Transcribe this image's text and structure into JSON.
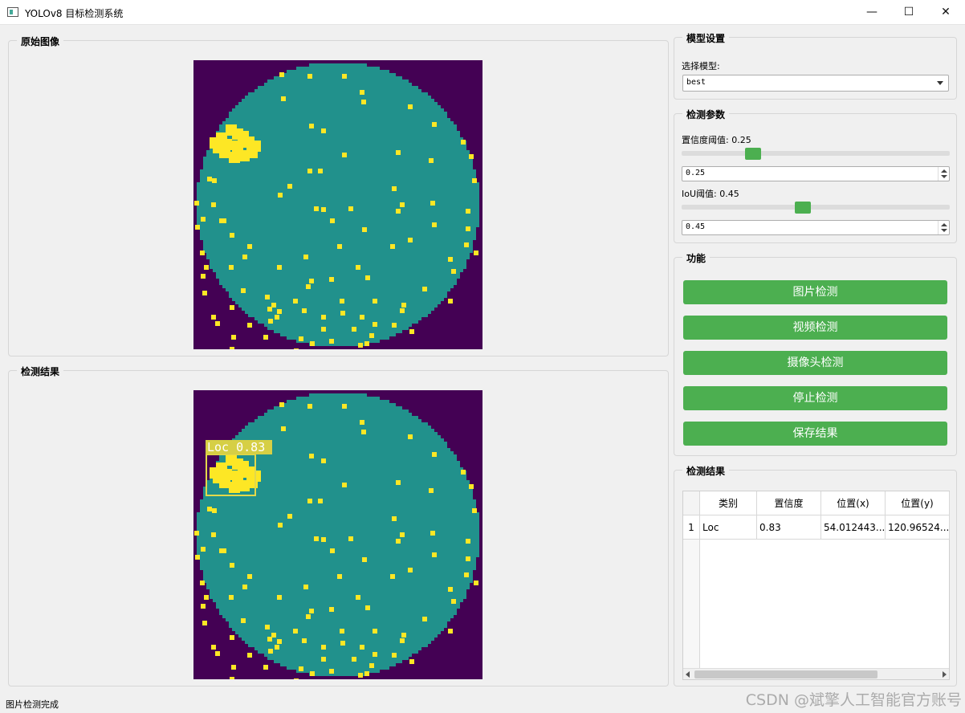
{
  "window": {
    "title": "YOLOv8 目标检测系统",
    "controls": {
      "minimize": "—",
      "maximize": "☐",
      "close": "✕"
    }
  },
  "left": {
    "original_title": "原始图像",
    "result_title": "检测结果",
    "detection_label": "Loc 0.83"
  },
  "model": {
    "group_title": "模型设置",
    "select_label": "选择模型:",
    "selected_model": "best"
  },
  "params": {
    "group_title": "检测参数",
    "conf_label": "置信度阈值: 0.25",
    "conf_value": "0.25",
    "conf_fraction": 0.25,
    "iou_label": "IoU阈值: 0.45",
    "iou_value": "0.45",
    "iou_fraction": 0.45
  },
  "functions": {
    "group_title": "功能",
    "buttons": [
      "图片检测",
      "视频检测",
      "摄像头检测",
      "停止检测",
      "保存结果"
    ]
  },
  "results": {
    "group_title": "检测结果",
    "headers": [
      "类别",
      "置信度",
      "位置(x)",
      "位置(y)"
    ],
    "rows": [
      {
        "index": "1",
        "cells": [
          "Loc",
          "0.83",
          "54.012443...",
          "120.96524..."
        ]
      }
    ]
  },
  "status": "图片检测完成",
  "watermark": "CSDN @斌擎人工智能官方账号",
  "colors": {
    "accent": "#4caf50",
    "image_background": "#440154",
    "circle": "#21918c",
    "dots": "#fde725"
  }
}
